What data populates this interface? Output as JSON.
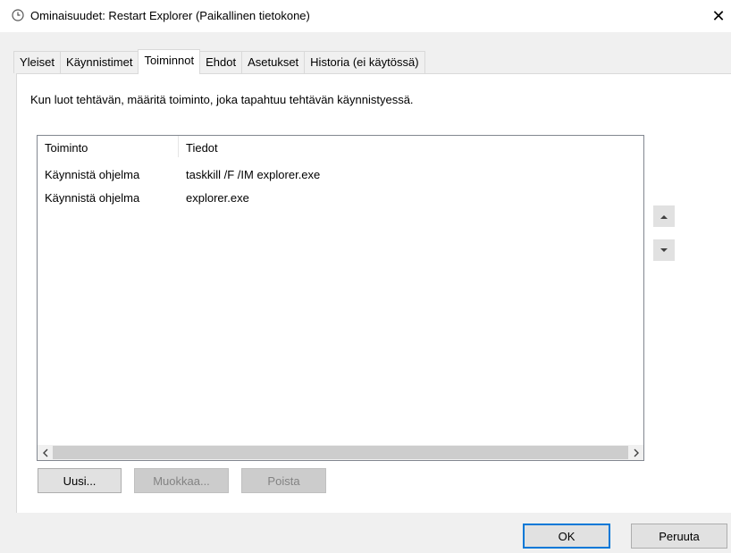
{
  "window": {
    "title": "Ominaisuudet: Restart Explorer (Paikallinen tietokone)",
    "close_glyph": "✕"
  },
  "tabs": [
    {
      "label": "Yleiset",
      "active": false
    },
    {
      "label": "Käynnistimet",
      "active": false
    },
    {
      "label": "Toiminnot",
      "active": true
    },
    {
      "label": "Ehdot",
      "active": false
    },
    {
      "label": "Asetukset",
      "active": false
    },
    {
      "label": "Historia (ei käytössä)",
      "active": false
    }
  ],
  "panel": {
    "description": "Kun luot tehtävän, määritä toiminto, joka tapahtuu tehtävän käynnistyessä."
  },
  "actions_list": {
    "columns": [
      "Toiminto",
      "Tiedot"
    ],
    "rows": [
      {
        "action": "Käynnistä ohjelma",
        "details": "taskkill /F /IM explorer.exe"
      },
      {
        "action": "Käynnistä ohjelma",
        "details": "explorer.exe"
      }
    ]
  },
  "buttons": {
    "new": "Uusi...",
    "edit": "Muokkaa...",
    "delete": "Poista",
    "ok": "OK",
    "cancel": "Peruuta"
  }
}
